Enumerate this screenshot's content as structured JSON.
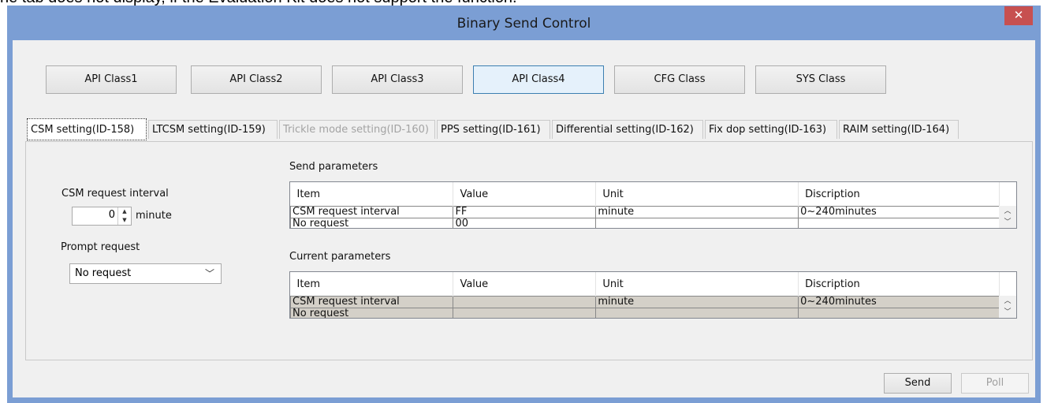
{
  "doc_text": "he tab does not display, if the Evaluation Kit does not support the function.",
  "window": {
    "title": "Binary Send Control",
    "close_glyph": "✕"
  },
  "class_buttons": [
    "API Class1",
    "API Class2",
    "API Class3",
    "API Class4",
    "CFG Class",
    "SYS Class"
  ],
  "active_class": "API Class4",
  "tabs": [
    {
      "label": "CSM setting(ID-158)",
      "state": "selected"
    },
    {
      "label": "LTCSM setting(ID-159)",
      "state": "normal"
    },
    {
      "label": "Trickle mode setting(ID-160)",
      "state": "disabled"
    },
    {
      "label": "PPS setting(ID-161)",
      "state": "normal"
    },
    {
      "label": "Differential setting(ID-162)",
      "state": "normal"
    },
    {
      "label": "Fix dop setting(ID-163)",
      "state": "normal"
    },
    {
      "label": "RAIM setting(ID-164)",
      "state": "normal"
    }
  ],
  "left_panel": {
    "interval_label": "CSM request interval",
    "interval_value": "0",
    "interval_unit": "minute",
    "prompt_label": "Prompt request",
    "prompt_value": "No request"
  },
  "send_params": {
    "title": "Send parameters",
    "columns": [
      "Item",
      "Value",
      "Unit",
      "Discription"
    ],
    "rows": [
      [
        "CSM request interval",
        "FF",
        "minute",
        "0~240minutes"
      ],
      [
        "No request",
        "00",
        "",
        ""
      ]
    ]
  },
  "current_params": {
    "title": "Current parameters",
    "columns": [
      "Item",
      "Value",
      "Unit",
      "Discription"
    ],
    "rows": [
      [
        "CSM request interval",
        "",
        "minute",
        "0~240minutes"
      ],
      [
        "No request",
        "",
        "",
        ""
      ]
    ]
  },
  "footer": {
    "send_label": "Send",
    "poll_label": "Poll"
  }
}
